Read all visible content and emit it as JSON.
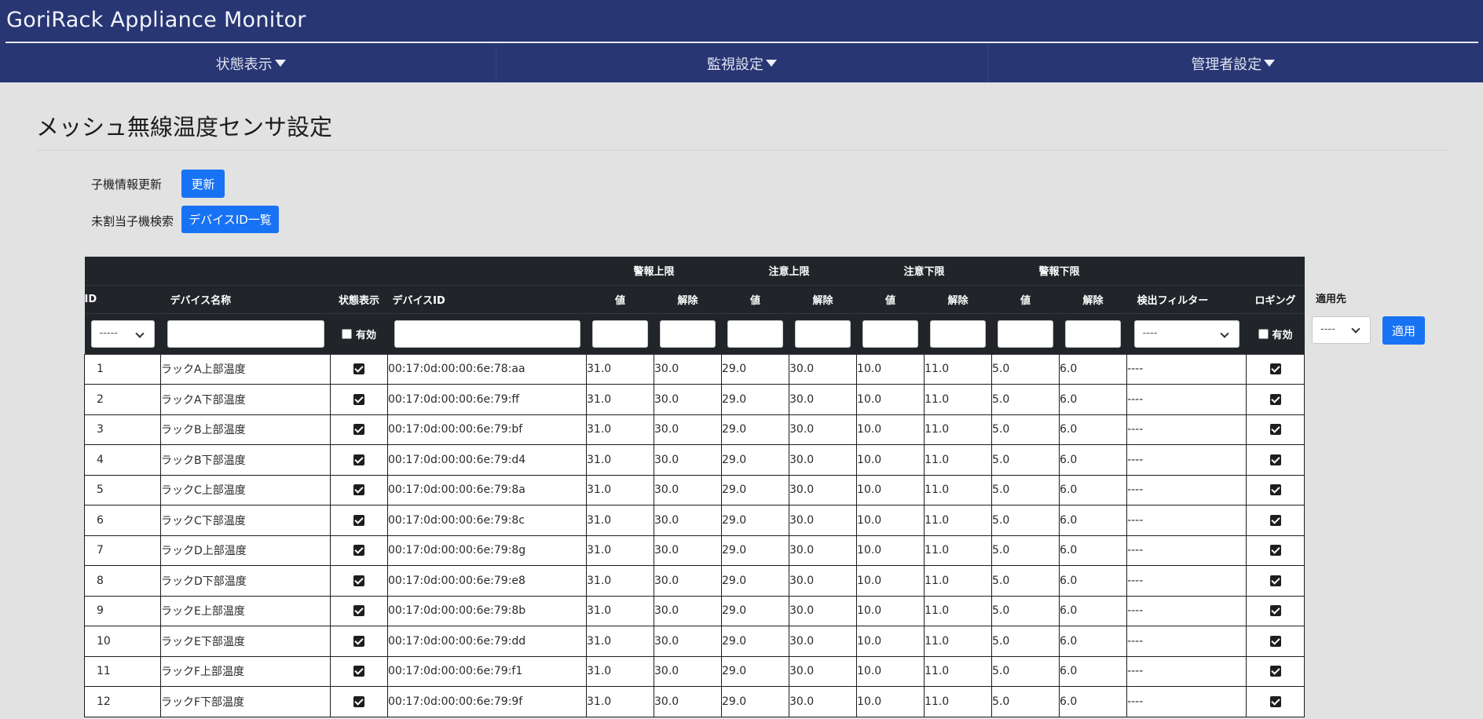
{
  "app": {
    "title": "GoriRack Appliance Monitor"
  },
  "nav": {
    "items": [
      {
        "label": "状態表示"
      },
      {
        "label": "監視設定"
      },
      {
        "label": "管理者設定"
      }
    ]
  },
  "page": {
    "title": "メッシュ無線温度センサ設定"
  },
  "controls": {
    "refresh_label": "子機情報更新",
    "refresh_button": "更新",
    "search_label": "未割当子機検索",
    "search_button": "デバイスID一覧"
  },
  "table": {
    "groups": {
      "alarm_upper": "警報上限",
      "caution_upper": "注意上限",
      "caution_lower": "注意下限",
      "alarm_lower": "警報下限"
    },
    "columns": {
      "id": "ID",
      "name": "デバイス名称",
      "status": "状態表示",
      "device_id": "デバイスID",
      "value": "値",
      "release": "解除",
      "filter": "検出フィルター",
      "logging": "ロギング"
    },
    "filters": {
      "id_select": "-----",
      "enabled_label": "有効",
      "filter_select": "----"
    },
    "rows": [
      {
        "id": "1",
        "name": "ラックA上部温度",
        "status": true,
        "device_id": "00:17:0d:00:00:6e:78:aa",
        "au_v": "31.0",
        "au_r": "30.0",
        "cu_v": "29.0",
        "cu_r": "30.0",
        "cl_v": "10.0",
        "cl_r": "11.0",
        "al_v": "5.0",
        "al_r": "6.0",
        "filter": "----",
        "logging": true
      },
      {
        "id": "2",
        "name": "ラックA下部温度",
        "status": true,
        "device_id": "00:17:0d:00:00:6e:79:ff",
        "au_v": "31.0",
        "au_r": "30.0",
        "cu_v": "29.0",
        "cu_r": "30.0",
        "cl_v": "10.0",
        "cl_r": "11.0",
        "al_v": "5.0",
        "al_r": "6.0",
        "filter": "----",
        "logging": true
      },
      {
        "id": "3",
        "name": "ラックB上部温度",
        "status": true,
        "device_id": "00:17:0d:00:00:6e:79:bf",
        "au_v": "31.0",
        "au_r": "30.0",
        "cu_v": "29.0",
        "cu_r": "30.0",
        "cl_v": "10.0",
        "cl_r": "11.0",
        "al_v": "5.0",
        "al_r": "6.0",
        "filter": "----",
        "logging": true
      },
      {
        "id": "4",
        "name": "ラックB下部温度",
        "status": true,
        "device_id": "00:17:0d:00:00:6e:79:d4",
        "au_v": "31.0",
        "au_r": "30.0",
        "cu_v": "29.0",
        "cu_r": "30.0",
        "cl_v": "10.0",
        "cl_r": "11.0",
        "al_v": "5.0",
        "al_r": "6.0",
        "filter": "----",
        "logging": true
      },
      {
        "id": "5",
        "name": "ラックC上部温度",
        "status": true,
        "device_id": "00:17:0d:00:00:6e:79:8a",
        "au_v": "31.0",
        "au_r": "30.0",
        "cu_v": "29.0",
        "cu_r": "30.0",
        "cl_v": "10.0",
        "cl_r": "11.0",
        "al_v": "5.0",
        "al_r": "6.0",
        "filter": "----",
        "logging": true
      },
      {
        "id": "6",
        "name": "ラックC下部温度",
        "status": true,
        "device_id": "00:17:0d:00:00:6e:79:8c",
        "au_v": "31.0",
        "au_r": "30.0",
        "cu_v": "29.0",
        "cu_r": "30.0",
        "cl_v": "10.0",
        "cl_r": "11.0",
        "al_v": "5.0",
        "al_r": "6.0",
        "filter": "----",
        "logging": true
      },
      {
        "id": "7",
        "name": "ラックD上部温度",
        "status": true,
        "device_id": "00:17:0d:00:00:6e:79:8g",
        "au_v": "31.0",
        "au_r": "30.0",
        "cu_v": "29.0",
        "cu_r": "30.0",
        "cl_v": "10.0",
        "cl_r": "11.0",
        "al_v": "5.0",
        "al_r": "6.0",
        "filter": "----",
        "logging": true
      },
      {
        "id": "8",
        "name": "ラックD下部温度",
        "status": true,
        "device_id": "00:17:0d:00:00:6e:79:e8",
        "au_v": "31.0",
        "au_r": "30.0",
        "cu_v": "29.0",
        "cu_r": "30.0",
        "cl_v": "10.0",
        "cl_r": "11.0",
        "al_v": "5.0",
        "al_r": "6.0",
        "filter": "----",
        "logging": true
      },
      {
        "id": "9",
        "name": "ラックE上部温度",
        "status": true,
        "device_id": "00:17:0d:00:00:6e:79:8b",
        "au_v": "31.0",
        "au_r": "30.0",
        "cu_v": "29.0",
        "cu_r": "30.0",
        "cl_v": "10.0",
        "cl_r": "11.0",
        "al_v": "5.0",
        "al_r": "6.0",
        "filter": "----",
        "logging": true
      },
      {
        "id": "10",
        "name": "ラックE下部温度",
        "status": true,
        "device_id": "00:17:0d:00:00:6e:79:dd",
        "au_v": "31.0",
        "au_r": "30.0",
        "cu_v": "29.0",
        "cu_r": "30.0",
        "cl_v": "10.0",
        "cl_r": "11.0",
        "al_v": "5.0",
        "al_r": "6.0",
        "filter": "----",
        "logging": true
      },
      {
        "id": "11",
        "name": "ラックF上部温度",
        "status": true,
        "device_id": "00:17:0d:00:00:6e:79:f1",
        "au_v": "31.0",
        "au_r": "30.0",
        "cu_v": "29.0",
        "cu_r": "30.0",
        "cl_v": "10.0",
        "cl_r": "11.0",
        "al_v": "5.0",
        "al_r": "6.0",
        "filter": "----",
        "logging": true
      },
      {
        "id": "12",
        "name": "ラックF下部温度",
        "status": true,
        "device_id": "00:17:0d:00:00:6e:79:9f",
        "au_v": "31.0",
        "au_r": "30.0",
        "cu_v": "29.0",
        "cu_r": "30.0",
        "cl_v": "10.0",
        "cl_r": "11.0",
        "al_v": "5.0",
        "al_r": "6.0",
        "filter": "----",
        "logging": true
      }
    ]
  },
  "apply": {
    "label": "適用先",
    "select": "----",
    "button": "適用"
  },
  "colors": {
    "header_bg": "#283673",
    "accent": "#1872f4",
    "table_head_bg": "#212529",
    "page_bg": "#e2e2e2"
  }
}
